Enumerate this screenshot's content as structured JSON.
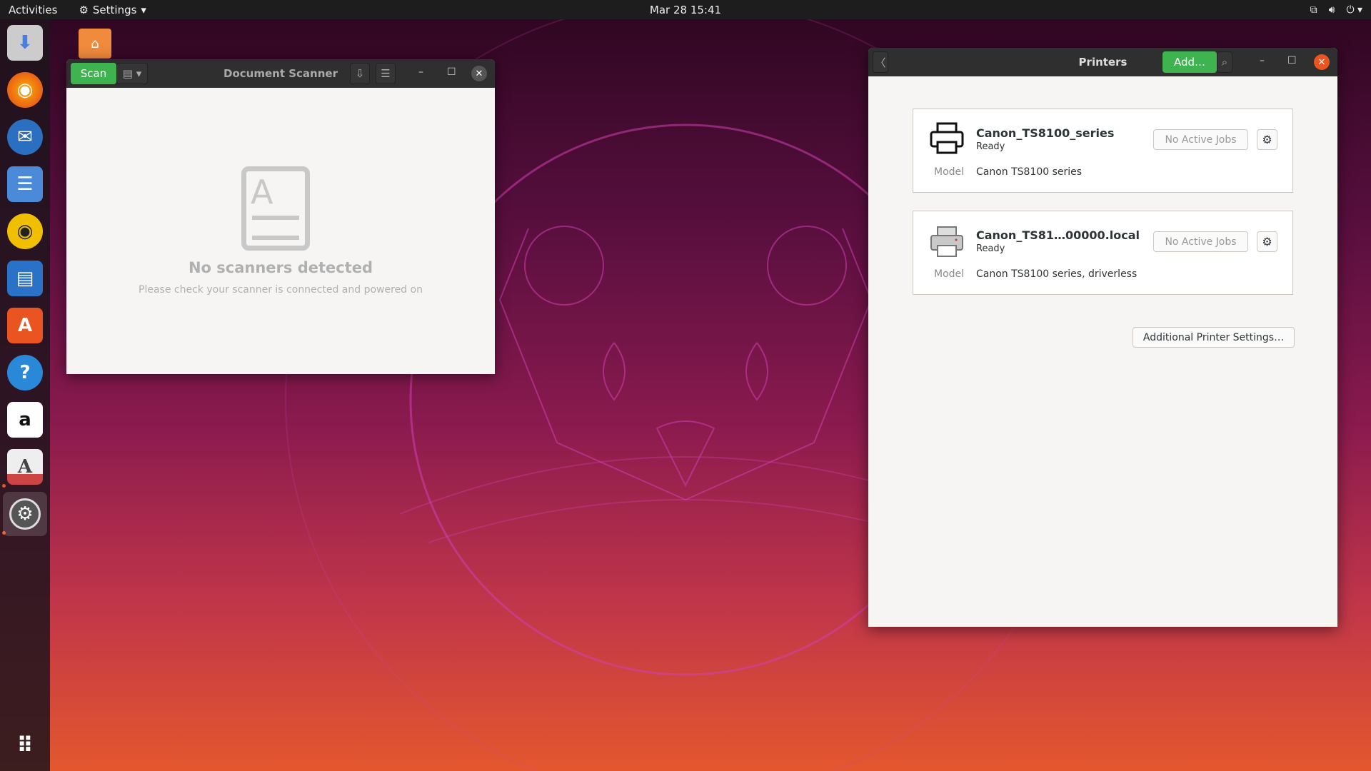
{
  "topbar": {
    "activities": "Activities",
    "app_menu": "Settings",
    "clock": "Mar 28  15:41"
  },
  "dock": {
    "items": [
      "Disk Image Writer",
      "Firefox",
      "Thunderbird",
      "Files",
      "Rhythmbox",
      "LibreOffice Writer",
      "Ubuntu Software",
      "Help",
      "Amazon",
      "Document Scanner",
      "Settings"
    ],
    "show_apps": "Show Applications"
  },
  "scanner": {
    "title": "Document Scanner",
    "scan_label": "Scan",
    "empty_title": "No scanners detected",
    "empty_text": "Please check your scanner is connected and powered on"
  },
  "printers": {
    "title": "Printers",
    "add_label": "Add…",
    "model_label": "Model",
    "list": [
      {
        "name": "Canon_TS8100_series",
        "status": "Ready",
        "jobs": "No Active Jobs",
        "model": "Canon TS8100 series"
      },
      {
        "name": "Canon_TS81…00000.local",
        "status": "Ready",
        "jobs": "No Active Jobs",
        "model": "Canon TS8100 series, driverless"
      }
    ],
    "additional": "Additional Printer Settings…"
  },
  "colors": {
    "accent": "#3eb34f",
    "close": "#e95420"
  }
}
